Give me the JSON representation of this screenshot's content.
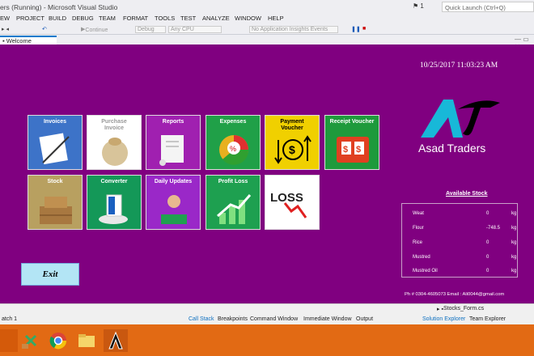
{
  "window": {
    "title": "ers (Running) - Microsoft Visual Studio",
    "flag_count": "1",
    "quick_launch_placeholder": "Quick Launch (Ctrl+Q)"
  },
  "menu": [
    "EW",
    "PROJECT",
    "BUILD",
    "DEBUG",
    "TEAM",
    "FORMAT",
    "TOOLS",
    "TEST",
    "ANALYZE",
    "WINDOW",
    "HELP"
  ],
  "toolbar": {
    "continue": "Continue",
    "config": "Debug",
    "platform": "Any CPU",
    "insights": "No Application Insights Events"
  },
  "tab": {
    "welcome": "Welcome"
  },
  "app": {
    "datetime": "10/25/2017 11:03:23 AM",
    "tiles": [
      {
        "label": "Invoices",
        "color": "#3d73c8"
      },
      {
        "label": "Purchase\nInvoice",
        "color": "#ffffff",
        "text_color": "#999999"
      },
      {
        "label": "Reports",
        "color": "#a020b0"
      },
      {
        "label": "Expenses",
        "color": "#20a048"
      },
      {
        "label": "Payment\nVoucher",
        "color": "#f0d000",
        "text_color": "#000000"
      },
      {
        "label": "Receipt Voucher",
        "color": "#1e9a3c"
      },
      {
        "label": "Stock",
        "color": "#b8a060"
      },
      {
        "label": "Converter",
        "color": "#149858"
      },
      {
        "label": "Daily Updates",
        "color": "#9a28c8"
      },
      {
        "label": "Profit Loss",
        "color": "#1ea050"
      },
      {
        "label": "",
        "color": "#ffffff"
      }
    ],
    "loss_graphic_text": "LOSS",
    "logo_text": "Asad Traders",
    "exit_label": "Exit",
    "stock": {
      "title": "Available Stock",
      "rows": [
        {
          "name": "Weat",
          "qty": "0",
          "unit": "kg"
        },
        {
          "name": "Flour",
          "qty": "-748.5",
          "unit": "kg"
        },
        {
          "name": "Rice",
          "qty": "0",
          "unit": "kg"
        },
        {
          "name": "Mustred",
          "qty": "0",
          "unit": "kg"
        },
        {
          "name": "Mustred Oil",
          "qty": "0",
          "unit": "kg"
        }
      ]
    },
    "contact": "Ph # 0304-4605073     Email : Ali0044@gmail.com"
  },
  "bottom": {
    "left": "atch 1",
    "tabs": [
      "Call Stack",
      "Breakpoints",
      "Command Window",
      "Immediate Window",
      "Output"
    ],
    "file": "Stocks_Form.cs",
    "right_tabs": [
      "Solution Explorer",
      "Team Explorer"
    ]
  }
}
